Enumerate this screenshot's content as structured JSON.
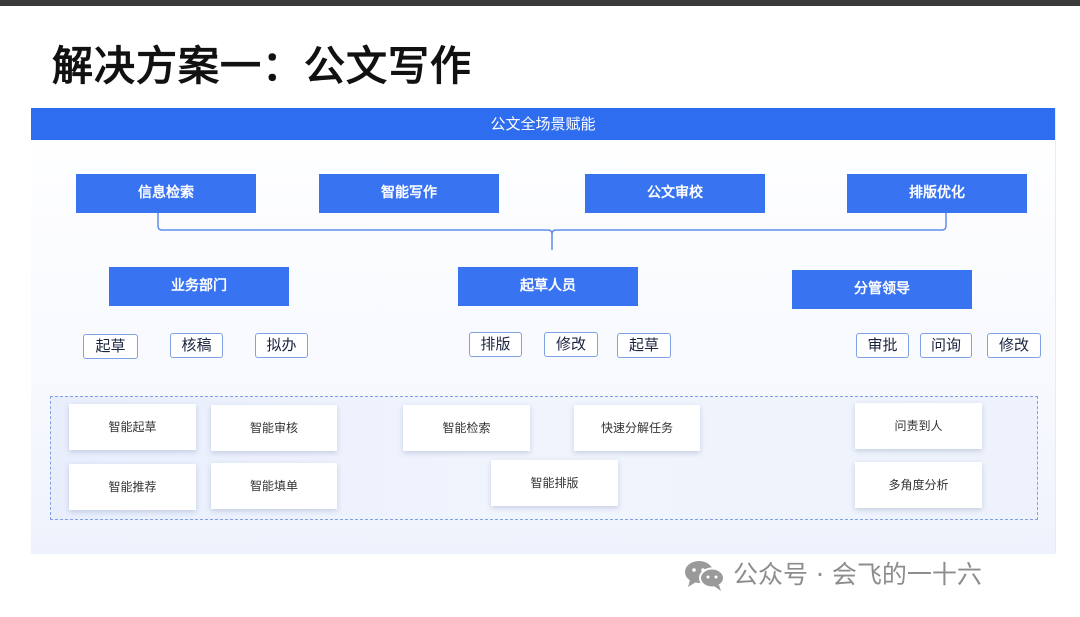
{
  "title": "解决方案一：公文写作",
  "panel": {
    "header": "公文全场景赋能",
    "capabilities": [
      "信息检索",
      "智能写作",
      "公文审校",
      "排版优化"
    ],
    "roles": [
      {
        "name": "业务部门",
        "tags": [
          "起草",
          "核稿",
          "拟办"
        ]
      },
      {
        "name": "起草人员",
        "tags": [
          "排版",
          "修改",
          "起草"
        ]
      },
      {
        "name": "分管领导",
        "tags": [
          "审批",
          "问询",
          "修改"
        ]
      }
    ],
    "features": [
      "智能起草",
      "智能审核",
      "智能推荐",
      "智能填单",
      "智能检索",
      "快速分解任务",
      "智能排版",
      "问责到人",
      "多角度分析"
    ]
  },
  "watermark": {
    "icon": "wechat-icon",
    "text": "公众号 · 会飞的一十六"
  }
}
